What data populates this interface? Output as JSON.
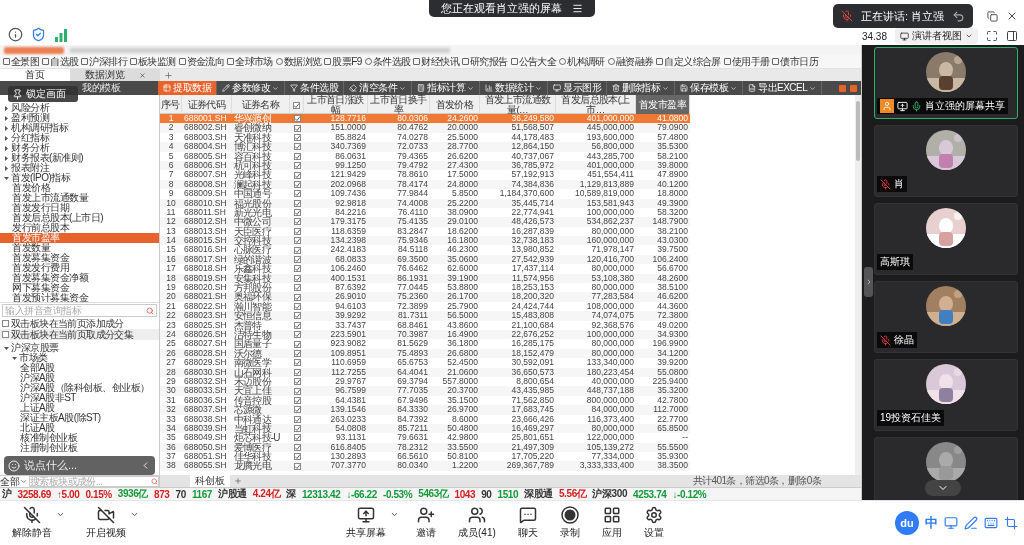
{
  "meeting": {
    "banner": "您正在观看肖立强的屏幕",
    "speaking": "正在讲话: 肖立强",
    "timer": "34.38",
    "view_mode": "演讲者视图"
  },
  "shared_screen": {
    "quick_toolbar": [
      {
        "label": "全景图",
        "kind": "page"
      },
      {
        "label": "自选股",
        "kind": "page"
      },
      {
        "label": "沪深排行",
        "kind": "page"
      },
      {
        "label": "板块监测",
        "kind": "page"
      },
      {
        "label": "资金流向",
        "kind": "page"
      },
      {
        "label": "全球市场",
        "kind": "page"
      },
      {
        "label": "数据浏览",
        "kind": "tool"
      },
      {
        "label": "股票F9",
        "kind": "page"
      },
      {
        "label": "条件选股",
        "kind": "tool"
      },
      {
        "label": "财经快讯",
        "kind": "page"
      },
      {
        "label": "研究报告",
        "kind": "page"
      },
      {
        "label": "公告大全",
        "kind": "page"
      },
      {
        "label": "机构调研",
        "kind": "tool"
      },
      {
        "label": "融资融券",
        "kind": "tool"
      },
      {
        "label": "自定义综合屏",
        "kind": "page"
      },
      {
        "label": "使用手册",
        "kind": "page"
      },
      {
        "label": "债市日历",
        "kind": "page"
      }
    ],
    "tabs": [
      {
        "label": "首页",
        "selected": true,
        "closable": false
      },
      {
        "label": "数据浏览",
        "selected": false,
        "closable": true
      }
    ],
    "lock_overlay": "锁定画面",
    "template_label": "我的模板",
    "actions": [
      {
        "label": "提取数据",
        "kind": "extract",
        "dropdown": false
      },
      {
        "label": "参数修改",
        "kind": "edit",
        "dropdown": true
      },
      {
        "label": "条件选股",
        "kind": "filter",
        "dropdown": false
      },
      {
        "label": "清空条件",
        "kind": "clear",
        "dropdown": true
      },
      {
        "label": "指标计算",
        "kind": "calc",
        "dropdown": true
      },
      {
        "label": "数据统计",
        "kind": "stats",
        "dropdown": true
      },
      {
        "label": "显示图形",
        "kind": "chart",
        "dropdown": false
      },
      {
        "label": "删除指标",
        "kind": "delete",
        "dropdown": true
      },
      {
        "label": "保存模板",
        "kind": "save",
        "dropdown": true
      },
      {
        "label": "导出EXCEL",
        "kind": "export",
        "dropdown": true
      }
    ],
    "indicator_tree": [
      {
        "label": "风险分析",
        "expanded": false
      },
      {
        "label": "盈利预测",
        "expanded": false
      },
      {
        "label": "机构调研指标",
        "expanded": false
      },
      {
        "label": "分红指标",
        "expanded": false
      },
      {
        "label": "财务分析",
        "expanded": false
      },
      {
        "label": "财务报表(新准则)",
        "expanded": false
      },
      {
        "label": "报表附注",
        "expanded": false
      },
      {
        "label": "首发(IPO)指标",
        "expanded": true,
        "children": [
          {
            "label": "首发价格",
            "selected": false
          },
          {
            "label": "首发上市流通数量",
            "selected": false
          },
          {
            "label": "首发发行日期",
            "selected": false
          },
          {
            "label": "首发后总股本(上市日)",
            "selected": false
          },
          {
            "label": "发行前总股本",
            "selected": false
          },
          {
            "label": "首发市盈率",
            "selected": true
          },
          {
            "label": "首发数量",
            "selected": false
          },
          {
            "label": "首发募集资金",
            "selected": false
          },
          {
            "label": "首发发行费用",
            "selected": false
          },
          {
            "label": "首发募集资金净额",
            "selected": false
          },
          {
            "label": "网下募集资金",
            "selected": false
          },
          {
            "label": "首发预计募集资金",
            "selected": false
          }
        ]
      }
    ],
    "indicator_search": {
      "placeholder": "输入拼音查询指标"
    },
    "options": [
      {
        "label": "双击板块在当前页添加成分",
        "checked": false
      },
      {
        "label": "双击板块在当前页取成分交集",
        "checked": false
      }
    ],
    "sector_tree": [
      {
        "label": "沪深京股票",
        "expanded": true,
        "children": [
          {
            "label": "市场类",
            "expanded": true,
            "children": [
              {
                "label": "全部A股"
              },
              {
                "label": "沪深A股"
              },
              {
                "label": "沪深A股（除科创板、创业板）"
              },
              {
                "label": "沪深A股非ST"
              },
              {
                "label": "上证A股"
              },
              {
                "label": "深证主板A股(除ST)"
              },
              {
                "label": "北证A股"
              },
              {
                "label": "核准制创业板"
              },
              {
                "label": "注册制创业板"
              }
            ]
          }
        ]
      }
    ],
    "chat_overlay": {
      "placeholder": "说点什么..."
    },
    "sector_filter": "全部",
    "sector_search": {
      "placeholder": "搜索板块或成份..."
    },
    "table": {
      "select_all_checked": true,
      "columns": [
        {
          "label": "序号",
          "kind": "index",
          "selected": false
        },
        {
          "label": "证券代码",
          "kind": "text",
          "selected": false
        },
        {
          "label": "证券名称",
          "kind": "text",
          "selected": false
        },
        {
          "label": "上市首日涨跌幅",
          "kind": "number",
          "selected": false
        },
        {
          "label": "上市首日换手率",
          "kind": "number",
          "selected": false
        },
        {
          "label": "首发价格",
          "kind": "number",
          "selected": false
        },
        {
          "label": "首发上市流通数量(…",
          "kind": "number",
          "selected": false
        },
        {
          "label": "首发后总股本(上市…",
          "kind": "number",
          "selected": false
        },
        {
          "label": "首发市盈率",
          "kind": "number",
          "selected": true
        }
      ],
      "rows": [
        {
          "cells": [
            "1",
            "688001.SH",
            "华兴源创",
            "128.7716",
            "80.0306",
            "24.2600",
            "36,249,580",
            "401,000,000",
            "41.0800"
          ],
          "checked": true,
          "selected": true
        },
        {
          "cells": [
            "2",
            "688002.SH",
            "睿创微纳",
            "151.0000",
            "80.4762",
            "20.0000",
            "51,568,507",
            "445,000,000",
            "79.0900"
          ],
          "checked": true,
          "selected": false
        },
        {
          "cells": [
            "3",
            "688003.SH",
            "天准科技",
            "85.8824",
            "74.0278",
            "25.5000",
            "44,178,483",
            "193,600,000",
            "57.4800"
          ],
          "checked": true,
          "selected": false
        },
        {
          "cells": [
            "4",
            "688004.SH",
            "博汇科技",
            "340.7369",
            "72.0733",
            "28.7700",
            "12,864,150",
            "56,800,000",
            "35.5300"
          ],
          "checked": true,
          "selected": false
        },
        {
          "cells": [
            "5",
            "688005.SH",
            "容百科技",
            "86.0631",
            "79.4365",
            "26.6200",
            "40,737,067",
            "443,285,700",
            "58.2100"
          ],
          "checked": true,
          "selected": false
        },
        {
          "cells": [
            "6",
            "688006.SH",
            "杭可科技",
            "99.1250",
            "79.4792",
            "27.4300",
            "36,785,972",
            "401,000,000",
            "39.8000"
          ],
          "checked": true,
          "selected": false
        },
        {
          "cells": [
            "7",
            "688007.SH",
            "光峰科技",
            "121.9429",
            "78.8610",
            "17.5000",
            "57,192,913",
            "451,554,411",
            "47.8900"
          ],
          "checked": true,
          "selected": false
        },
        {
          "cells": [
            "8",
            "688008.SH",
            "澜起科技",
            "202.0968",
            "78.4174",
            "24.8000",
            "74,384,836",
            "1,129,813,889",
            "40.1200"
          ],
          "checked": true,
          "selected": false
        },
        {
          "cells": [
            "9",
            "688009.SH",
            "中国通号",
            "109.7436",
            "77.9844",
            "5.8500",
            "1,184,370,600",
            "10,589,819,000",
            "18.8000"
          ],
          "checked": true,
          "selected": false
        },
        {
          "cells": [
            "10",
            "688010.SH",
            "福光股份",
            "92.9818",
            "74.4008",
            "25.2200",
            "35,445,714",
            "153,581,943",
            "49.3900"
          ],
          "checked": true,
          "selected": false
        },
        {
          "cells": [
            "11",
            "688011.SH",
            "新光光电",
            "84.2216",
            "76.4110",
            "38.0900",
            "22,774,941",
            "100,000,000",
            "58.3200"
          ],
          "checked": true,
          "selected": false
        },
        {
          "cells": [
            "12",
            "688012.SH",
            "中微公司",
            "179.3175",
            "75.4135",
            "29.0100",
            "48,426,573",
            "534,862,237",
            "148.7900"
          ],
          "checked": true,
          "selected": false
        },
        {
          "cells": [
            "13",
            "688013.SH",
            "天臣医疗",
            "118.6359",
            "83.2847",
            "18.6200",
            "16,287,839",
            "80,000,000",
            "38.2100"
          ],
          "checked": true,
          "selected": false
        },
        {
          "cells": [
            "14",
            "688015.SH",
            "交控科技",
            "134.2398",
            "75.9346",
            "16.1800",
            "32,738,183",
            "160,000,000",
            "43.0300"
          ],
          "checked": true,
          "selected": false
        },
        {
          "cells": [
            "15",
            "688016.SH",
            "心脉医疗",
            "242.4183",
            "84.5118",
            "46.2300",
            "13,980,852",
            "71,978,147",
            "39.7500"
          ],
          "checked": true,
          "selected": false
        },
        {
          "cells": [
            "16",
            "688017.SH",
            "绿的谐波",
            "68.0833",
            "69.3500",
            "35.0600",
            "27,542,939",
            "120,416,700",
            "106.2400"
          ],
          "checked": true,
          "selected": false
        },
        {
          "cells": [
            "17",
            "688018.SH",
            "乐鑫科技",
            "106.2460",
            "76.6462",
            "62.6000",
            "17,437,114",
            "80,000,000",
            "56.6700"
          ],
          "checked": true,
          "selected": false
        },
        {
          "cells": [
            "18",
            "688019.SH",
            "安集科技",
            "400.1531",
            "86.1931",
            "39.1900",
            "11,574,956",
            "53,108,380",
            "48.2600"
          ],
          "checked": true,
          "selected": false
        },
        {
          "cells": [
            "19",
            "688020.SH",
            "方邦股份",
            "87.6392",
            "77.0445",
            "53.8800",
            "18,253,153",
            "80,000,000",
            "38.5100"
          ],
          "checked": true,
          "selected": false
        },
        {
          "cells": [
            "20",
            "688021.SH",
            "奥福环保",
            "26.9010",
            "75.2360",
            "26.1700",
            "18,200,320",
            "77,283,584",
            "46.6200"
          ],
          "checked": true,
          "selected": false
        },
        {
          "cells": [
            "21",
            "688022.SH",
            "瀚川智能",
            "94.6103",
            "72.3899",
            "25.7900",
            "24,424,744",
            "108,000,000",
            "44.3600"
          ],
          "checked": true,
          "selected": false
        },
        {
          "cells": [
            "22",
            "688023.SH",
            "安恒信息",
            "39.9292",
            "81.7311",
            "56.5000",
            "15,483,808",
            "74,074,075",
            "72.3800"
          ],
          "checked": true,
          "selected": false
        },
        {
          "cells": [
            "23",
            "688025.SH",
            "杰普特",
            "33.7437",
            "68.8461",
            "43.8600",
            "21,100,684",
            "92,368,576",
            "49.0200"
          ],
          "checked": true,
          "selected": false
        },
        {
          "cells": [
            "24",
            "688026.SH",
            "洁特生物",
            "223.5901",
            "70.3987",
            "16.4900",
            "22,676,252",
            "100,000,000",
            "34.9300"
          ],
          "checked": true,
          "selected": false
        },
        {
          "cells": [
            "25",
            "688027.SH",
            "国盾量子",
            "923.9082",
            "81.5629",
            "36.1800",
            "16,285,175",
            "80,000,000",
            "196.9900"
          ],
          "checked": true,
          "selected": false
        },
        {
          "cells": [
            "26",
            "688028.SH",
            "沃尔德",
            "109.8951",
            "75.4893",
            "26.6800",
            "18,152,479",
            "80,000,000",
            "34.1200"
          ],
          "checked": true,
          "selected": false
        },
        {
          "cells": [
            "27",
            "688029.SH",
            "南微医学",
            "110.6959",
            "65.6753",
            "52.4500",
            "30,592,091",
            "133,340,000",
            "39.9200"
          ],
          "checked": true,
          "selected": false
        },
        {
          "cells": [
            "28",
            "688030.SH",
            "山石网科",
            "112.7255",
            "64.4041",
            "21.0600",
            "36,650,573",
            "180,223,454",
            "55.0800"
          ],
          "checked": true,
          "selected": false
        },
        {
          "cells": [
            "29",
            "688032.SH",
            "禾迈股份",
            "29.9767",
            "69.3794",
            "557.8000",
            "8,800,654",
            "40,000,000",
            "225.9400"
          ],
          "checked": true,
          "selected": false
        },
        {
          "cells": [
            "30",
            "688033.SH",
            "天宜上佳",
            "96.7599",
            "77.7035",
            "20.3700",
            "43,435,985",
            "448,737,188",
            "35.3200"
          ],
          "checked": true,
          "selected": false
        },
        {
          "cells": [
            "31",
            "688036.SH",
            "传音控股",
            "64.4381",
            "67.9496",
            "35.1500",
            "71,562,850",
            "800,000,000",
            "42.7800"
          ],
          "checked": true,
          "selected": false
        },
        {
          "cells": [
            "32",
            "688037.SH",
            "芯源微",
            "139.1546",
            "84.3330",
            "26.9700",
            "17,683,745",
            "84,000,000",
            "112.7000"
          ],
          "checked": true,
          "selected": false
        },
        {
          "cells": [
            "33",
            "688038.SH",
            "中科通达",
            "263.0233",
            "84.7392",
            "8.6000",
            "23,666,426",
            "116,373,400",
            "22.7700"
          ],
          "checked": true,
          "selected": false
        },
        {
          "cells": [
            "34",
            "688039.SH",
            "当虹科技",
            "54.0808",
            "85.7211",
            "50.4800",
            "16,469,297",
            "80,000,000",
            "65.8500"
          ],
          "checked": true,
          "selected": false
        },
        {
          "cells": [
            "35",
            "688049.SH",
            "炬芯科技-U",
            "93.1131",
            "79.6631",
            "42.9800",
            "25,801,651",
            "122,000,000",
            "--"
          ],
          "checked": true,
          "selected": false
        },
        {
          "cells": [
            "36",
            "688050.SH",
            "爱博医疗",
            "616.8405",
            "78.2312",
            "33.5500",
            "21,497,309",
            "105,139,272",
            "55.5500"
          ],
          "checked": true,
          "selected": false
        },
        {
          "cells": [
            "37",
            "688051.SH",
            "佳华科技",
            "130.2893",
            "66.5610",
            "50.8100",
            "17,705,220",
            "77,334,000",
            "35.9300"
          ],
          "checked": true,
          "selected": false
        },
        {
          "cells": [
            "38",
            "688055.SH",
            "龙腾光电",
            "707.3770",
            "80.0340",
            "1.2200",
            "269,367,789",
            "3,333,333,400",
            "38.3500"
          ],
          "checked": true,
          "selected": false
        }
      ]
    },
    "sheet_tabs": [
      {
        "label": "科创板",
        "selected": true
      }
    ],
    "status": "共计401条，筛选0条，删除0条",
    "ticker": [
      {
        "text": "沪",
        "color": "#333333"
      },
      {
        "text": "3258.69",
        "color": "#d42020"
      },
      {
        "text": "↑5.00",
        "color": "#d42020"
      },
      {
        "text": "0.15%",
        "color": "#d42020"
      },
      {
        "text": "3936亿",
        "color": "#139a3a"
      },
      {
        "text": "873",
        "color": "#d42020"
      },
      {
        "text": "70",
        "color": "#333333"
      },
      {
        "text": "1167",
        "color": "#139a3a"
      },
      {
        "text": "沪股通",
        "color": "#333333"
      },
      {
        "text": "4.24亿",
        "color": "#d42020"
      },
      {
        "text": "深",
        "color": "#333333"
      },
      {
        "text": "12313.42",
        "color": "#139a3a"
      },
      {
        "text": "↓-66.22",
        "color": "#139a3a"
      },
      {
        "text": "-0.53%",
        "color": "#139a3a"
      },
      {
        "text": "5463亿",
        "color": "#139a3a"
      },
      {
        "text": "1043",
        "color": "#d42020"
      },
      {
        "text": "90",
        "color": "#333333"
      },
      {
        "text": "1510",
        "color": "#139a3a"
      },
      {
        "text": "深股通",
        "color": "#333333"
      },
      {
        "text": "5.56亿",
        "color": "#d42020"
      },
      {
        "text": "沪深300",
        "color": "#333333"
      },
      {
        "text": "4253.74",
        "color": "#139a3a"
      },
      {
        "text": "↓-0.12%",
        "color": "#139a3a"
      }
    ]
  },
  "participants": [
    {
      "name": "肖立强的屏幕共享",
      "muted": false,
      "sharing": true,
      "active": true
    },
    {
      "name": "肖",
      "muted": true,
      "sharing": false,
      "active": false
    },
    {
      "name": "高斯琪",
      "sharing": false,
      "active": false
    },
    {
      "name": "徐晶",
      "muted": true,
      "sharing": false,
      "active": false
    },
    {
      "name": "19投资石佳美",
      "sharing": false,
      "active": false
    },
    {
      "sharing": false,
      "active": false
    }
  ],
  "toolbar": [
    {
      "label": "解除静音",
      "kind": "mic-off",
      "dropdown": true
    },
    {
      "label": "开启视频",
      "kind": "video-off",
      "dropdown": true
    },
    {
      "label": "共享屏幕",
      "kind": "share",
      "dropdown": true
    },
    {
      "label": "邀请",
      "kind": "invite",
      "dropdown": false
    },
    {
      "label": "成员(41)",
      "kind": "members",
      "dropdown": false
    },
    {
      "label": "聊天",
      "kind": "chat",
      "dropdown": false
    },
    {
      "label": "录制",
      "kind": "record",
      "dropdown": false
    },
    {
      "label": "应用",
      "kind": "apps",
      "dropdown": false
    },
    {
      "label": "设置",
      "kind": "settings",
      "dropdown": false
    }
  ],
  "ime": {
    "logo": "du",
    "mode": "中"
  }
}
